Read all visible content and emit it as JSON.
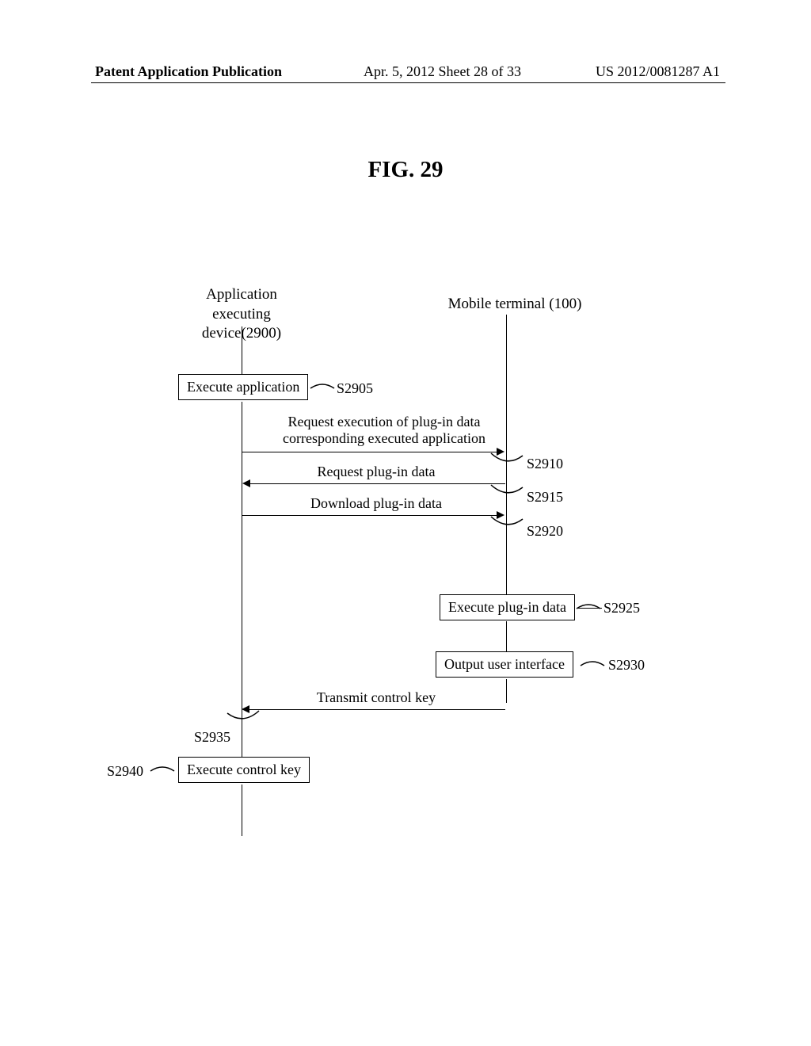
{
  "header": {
    "left": "Patent Application Publication",
    "center": "Apr. 5, 2012  Sheet 28 of 33",
    "right": "US 2012/0081287 A1"
  },
  "figTitle": "FIG. 29",
  "actors": {
    "left": {
      "line1": "Application executing",
      "line2": "device(2900)"
    },
    "right": "Mobile terminal (100)"
  },
  "boxes": {
    "execApp": "Execute application",
    "execPlugin": "Execute plug-in data",
    "outputUI": "Output user interface",
    "execControl": "Execute control key"
  },
  "messages": {
    "m1": {
      "line1": "Request execution of plug-in data",
      "line2": "corresponding executed application"
    },
    "m2": "Request plug-in data",
    "m3": "Download plug-in data",
    "m4": "Transmit control key"
  },
  "steps": {
    "s2905": "S2905",
    "s2910": "S2910",
    "s2915": "S2915",
    "s2920": "S2920",
    "s2925": "S2925",
    "s2930": "S2930",
    "s2935": "S2935",
    "s2940": "S2940"
  }
}
